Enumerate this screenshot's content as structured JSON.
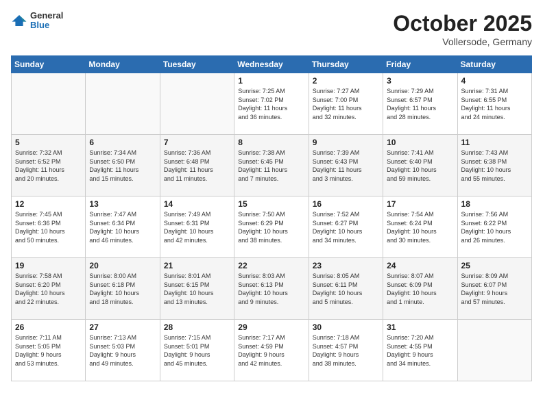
{
  "header": {
    "logo": {
      "general": "General",
      "blue": "Blue"
    },
    "title": "October 2025",
    "location": "Vollersode, Germany"
  },
  "weekdays": [
    "Sunday",
    "Monday",
    "Tuesday",
    "Wednesday",
    "Thursday",
    "Friday",
    "Saturday"
  ],
  "weeks": [
    [
      {
        "day": "",
        "info": ""
      },
      {
        "day": "",
        "info": ""
      },
      {
        "day": "",
        "info": ""
      },
      {
        "day": "1",
        "info": "Sunrise: 7:25 AM\nSunset: 7:02 PM\nDaylight: 11 hours\nand 36 minutes."
      },
      {
        "day": "2",
        "info": "Sunrise: 7:27 AM\nSunset: 7:00 PM\nDaylight: 11 hours\nand 32 minutes."
      },
      {
        "day": "3",
        "info": "Sunrise: 7:29 AM\nSunset: 6:57 PM\nDaylight: 11 hours\nand 28 minutes."
      },
      {
        "day": "4",
        "info": "Sunrise: 7:31 AM\nSunset: 6:55 PM\nDaylight: 11 hours\nand 24 minutes."
      }
    ],
    [
      {
        "day": "5",
        "info": "Sunrise: 7:32 AM\nSunset: 6:52 PM\nDaylight: 11 hours\nand 20 minutes."
      },
      {
        "day": "6",
        "info": "Sunrise: 7:34 AM\nSunset: 6:50 PM\nDaylight: 11 hours\nand 15 minutes."
      },
      {
        "day": "7",
        "info": "Sunrise: 7:36 AM\nSunset: 6:48 PM\nDaylight: 11 hours\nand 11 minutes."
      },
      {
        "day": "8",
        "info": "Sunrise: 7:38 AM\nSunset: 6:45 PM\nDaylight: 11 hours\nand 7 minutes."
      },
      {
        "day": "9",
        "info": "Sunrise: 7:39 AM\nSunset: 6:43 PM\nDaylight: 11 hours\nand 3 minutes."
      },
      {
        "day": "10",
        "info": "Sunrise: 7:41 AM\nSunset: 6:40 PM\nDaylight: 10 hours\nand 59 minutes."
      },
      {
        "day": "11",
        "info": "Sunrise: 7:43 AM\nSunset: 6:38 PM\nDaylight: 10 hours\nand 55 minutes."
      }
    ],
    [
      {
        "day": "12",
        "info": "Sunrise: 7:45 AM\nSunset: 6:36 PM\nDaylight: 10 hours\nand 50 minutes."
      },
      {
        "day": "13",
        "info": "Sunrise: 7:47 AM\nSunset: 6:34 PM\nDaylight: 10 hours\nand 46 minutes."
      },
      {
        "day": "14",
        "info": "Sunrise: 7:49 AM\nSunset: 6:31 PM\nDaylight: 10 hours\nand 42 minutes."
      },
      {
        "day": "15",
        "info": "Sunrise: 7:50 AM\nSunset: 6:29 PM\nDaylight: 10 hours\nand 38 minutes."
      },
      {
        "day": "16",
        "info": "Sunrise: 7:52 AM\nSunset: 6:27 PM\nDaylight: 10 hours\nand 34 minutes."
      },
      {
        "day": "17",
        "info": "Sunrise: 7:54 AM\nSunset: 6:24 PM\nDaylight: 10 hours\nand 30 minutes."
      },
      {
        "day": "18",
        "info": "Sunrise: 7:56 AM\nSunset: 6:22 PM\nDaylight: 10 hours\nand 26 minutes."
      }
    ],
    [
      {
        "day": "19",
        "info": "Sunrise: 7:58 AM\nSunset: 6:20 PM\nDaylight: 10 hours\nand 22 minutes."
      },
      {
        "day": "20",
        "info": "Sunrise: 8:00 AM\nSunset: 6:18 PM\nDaylight: 10 hours\nand 18 minutes."
      },
      {
        "day": "21",
        "info": "Sunrise: 8:01 AM\nSunset: 6:15 PM\nDaylight: 10 hours\nand 13 minutes."
      },
      {
        "day": "22",
        "info": "Sunrise: 8:03 AM\nSunset: 6:13 PM\nDaylight: 10 hours\nand 9 minutes."
      },
      {
        "day": "23",
        "info": "Sunrise: 8:05 AM\nSunset: 6:11 PM\nDaylight: 10 hours\nand 5 minutes."
      },
      {
        "day": "24",
        "info": "Sunrise: 8:07 AM\nSunset: 6:09 PM\nDaylight: 10 hours\nand 1 minute."
      },
      {
        "day": "25",
        "info": "Sunrise: 8:09 AM\nSunset: 6:07 PM\nDaylight: 9 hours\nand 57 minutes."
      }
    ],
    [
      {
        "day": "26",
        "info": "Sunrise: 7:11 AM\nSunset: 5:05 PM\nDaylight: 9 hours\nand 53 minutes."
      },
      {
        "day": "27",
        "info": "Sunrise: 7:13 AM\nSunset: 5:03 PM\nDaylight: 9 hours\nand 49 minutes."
      },
      {
        "day": "28",
        "info": "Sunrise: 7:15 AM\nSunset: 5:01 PM\nDaylight: 9 hours\nand 45 minutes."
      },
      {
        "day": "29",
        "info": "Sunrise: 7:17 AM\nSunset: 4:59 PM\nDaylight: 9 hours\nand 42 minutes."
      },
      {
        "day": "30",
        "info": "Sunrise: 7:18 AM\nSunset: 4:57 PM\nDaylight: 9 hours\nand 38 minutes."
      },
      {
        "day": "31",
        "info": "Sunrise: 7:20 AM\nSunset: 4:55 PM\nDaylight: 9 hours\nand 34 minutes."
      },
      {
        "day": "",
        "info": ""
      }
    ]
  ]
}
